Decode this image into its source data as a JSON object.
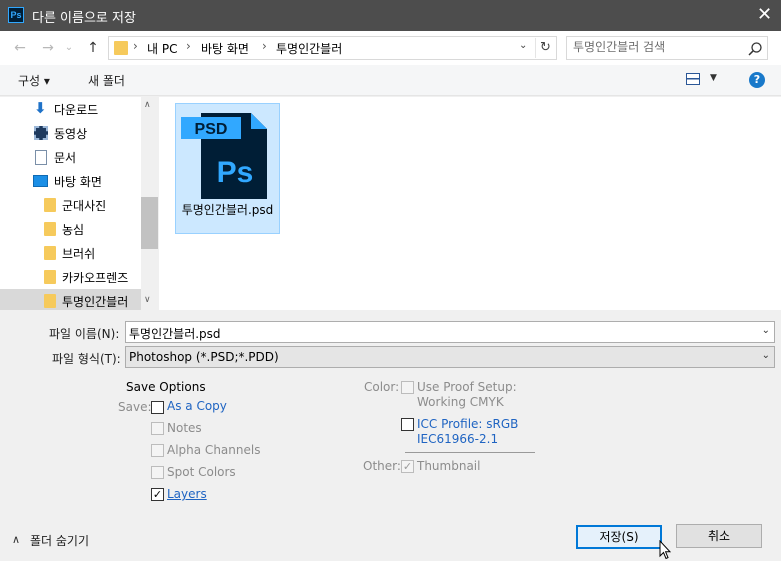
{
  "window": {
    "app_icon": "Ps",
    "title": "다른 이름으로 저장",
    "close_glyph": "✕"
  },
  "nav": {
    "back_glyph": "←",
    "forward_glyph": "→",
    "recent_glyph": "⌄",
    "up_glyph": "↑"
  },
  "address": {
    "crumbs": [
      "내 PC",
      "바탕 화면",
      "투명인간블러"
    ],
    "sep_glyph": "›",
    "dropdown_glyph": "⌄",
    "refresh_glyph": "↻"
  },
  "search": {
    "placeholder": "투명인간블러 검색"
  },
  "toolbar": {
    "organize_label": "구성 ▾",
    "new_folder_label": "새 폴더",
    "view_dropdown_glyph": "▼",
    "help_glyph": "?"
  },
  "sidebar": {
    "items": [
      {
        "label": "다운로드",
        "icon": "download-icon"
      },
      {
        "label": "동영상",
        "icon": "video-icon"
      },
      {
        "label": "문서",
        "icon": "document-icon"
      },
      {
        "label": "바탕 화면",
        "icon": "desktop-icon"
      },
      {
        "label": "군대사진",
        "icon": "folder-icon"
      },
      {
        "label": "농심",
        "icon": "folder-icon"
      },
      {
        "label": "브러쉬",
        "icon": "folder-icon"
      },
      {
        "label": "카카오프렌즈",
        "icon": "folder-icon"
      },
      {
        "label": "투명인간블러",
        "icon": "folder-icon",
        "selected": true
      }
    ],
    "scroll_up_glyph": "∧",
    "scroll_down_glyph": "∨"
  },
  "files": [
    {
      "name": "투명인간블러.psd",
      "icon_badge": "PSD",
      "icon_letters": "Ps",
      "selected": true
    }
  ],
  "form": {
    "filename_label": "파일 이름(N):",
    "filename_value": "투명인간블러.psd",
    "filetype_label": "파일 형식(T):",
    "filetype_value": "Photoshop (*.PSD;*.PDD)",
    "combo_arrow_glyph": "⌄"
  },
  "save_options": {
    "heading": "Save Options",
    "save_label": "Save:",
    "as_a_copy": {
      "label": "As a Copy",
      "checked": false,
      "enabled": true
    },
    "notes": {
      "label": "Notes",
      "checked": false,
      "enabled": false
    },
    "alpha_channels": {
      "label": "Alpha Channels",
      "checked": false,
      "enabled": false
    },
    "spot_colors": {
      "label": "Spot Colors",
      "checked": false,
      "enabled": false
    },
    "layers": {
      "label": "Layers",
      "checked": true,
      "enabled": true
    },
    "color_label": "Color:",
    "use_proof_setup": {
      "label": "Use Proof Setup:",
      "sub": "Working CMYK",
      "checked": false,
      "enabled": false
    },
    "icc_profile": {
      "label": "ICC Profile:  sRGB",
      "sub": "IEC61966-2.1",
      "checked": false,
      "enabled": true
    },
    "other_label": "Other:",
    "thumbnail": {
      "label": "Thumbnail",
      "checked": true,
      "enabled": false
    },
    "check_glyph": "✓"
  },
  "footer": {
    "hide_folders_label": "폴더 숨기기",
    "hide_folders_glyph": "∧",
    "save_button": "저장(S)",
    "cancel_button": "취소"
  },
  "colors": {
    "titlebar": "#4d4d4d",
    "selection": "#cce8ff",
    "link": "#1f64c2",
    "ps_blue": "#31a8ff",
    "ps_dark": "#001e36"
  }
}
